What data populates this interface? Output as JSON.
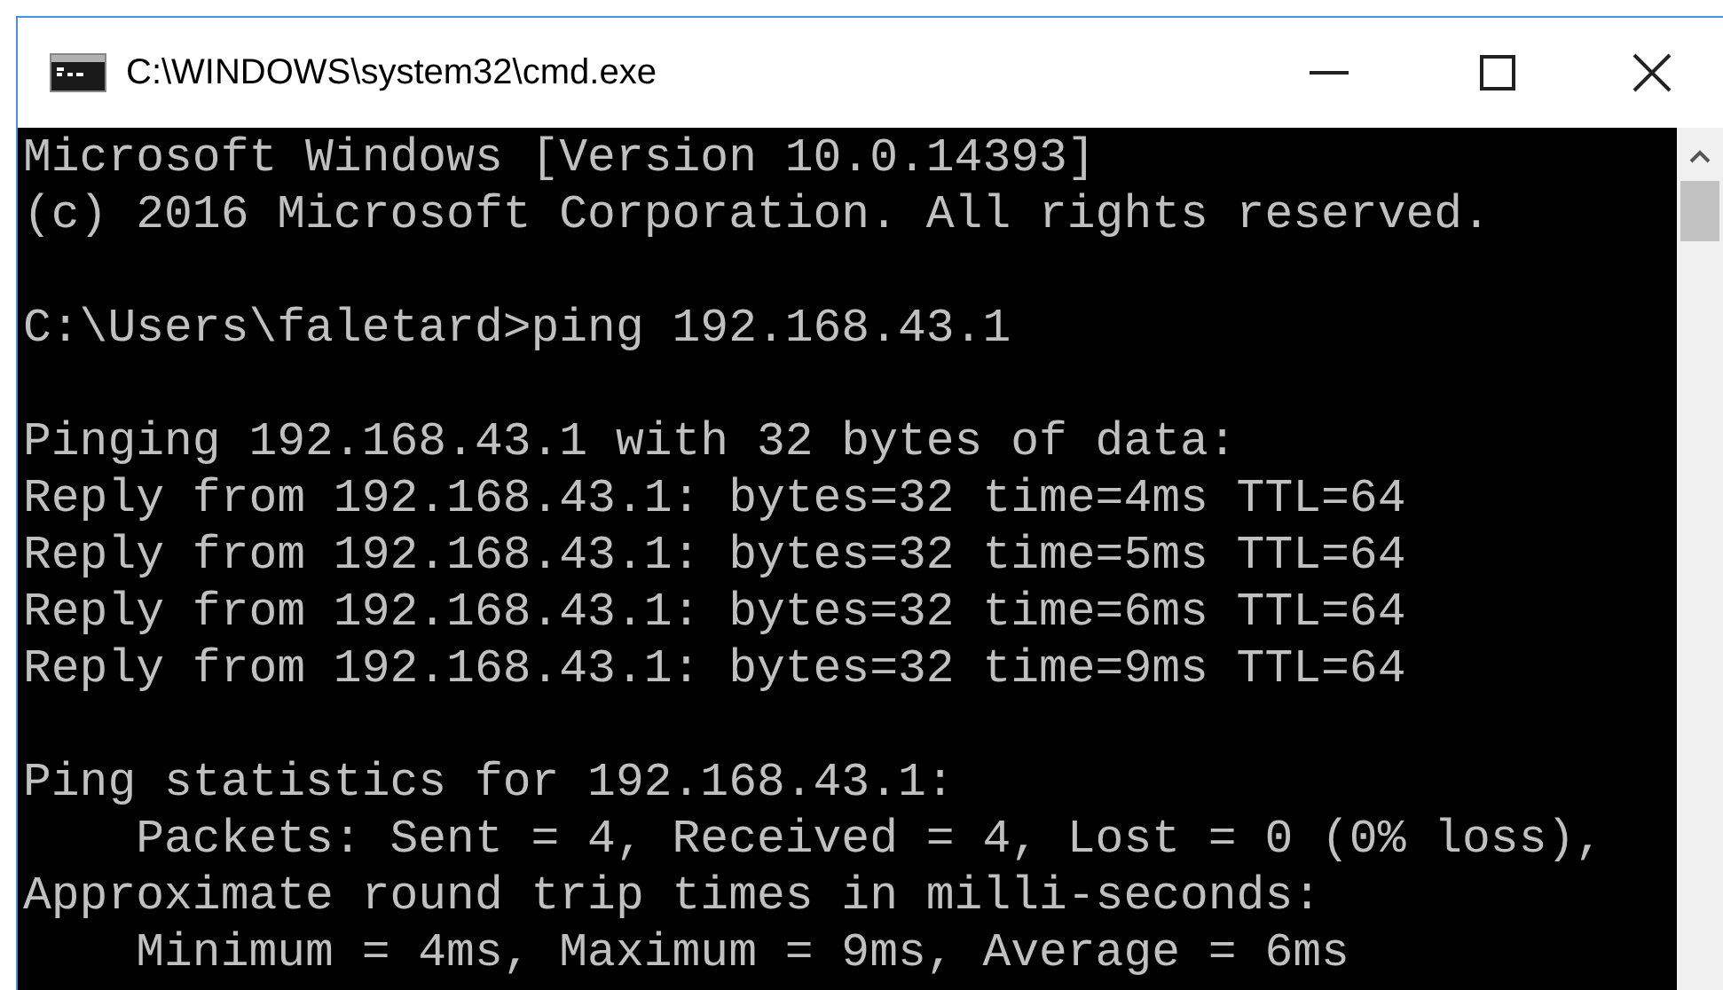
{
  "window": {
    "title": "C:\\WINDOWS\\system32\\cmd.exe"
  },
  "console": {
    "blocks": [
      [
        "Microsoft Windows [Version 10.0.14393]",
        "(c) 2016 Microsoft Corporation. All rights reserved."
      ],
      [
        "C:\\Users\\faletard>ping 192.168.43.1"
      ],
      [
        "Pinging 192.168.43.1 with 32 bytes of data:",
        "Reply from 192.168.43.1: bytes=32 time=4ms TTL=64",
        "Reply from 192.168.43.1: bytes=32 time=5ms TTL=64",
        "Reply from 192.168.43.1: bytes=32 time=6ms TTL=64",
        "Reply from 192.168.43.1: bytes=32 time=9ms TTL=64"
      ],
      [
        "Ping statistics for 192.168.43.1:",
        "    Packets: Sent = 4, Received = 4, Lost = 0 (0% loss),",
        "Approximate round trip times in milli-seconds:",
        "    Minimum = 4ms, Maximum = 9ms, Average = 6ms"
      ]
    ]
  }
}
